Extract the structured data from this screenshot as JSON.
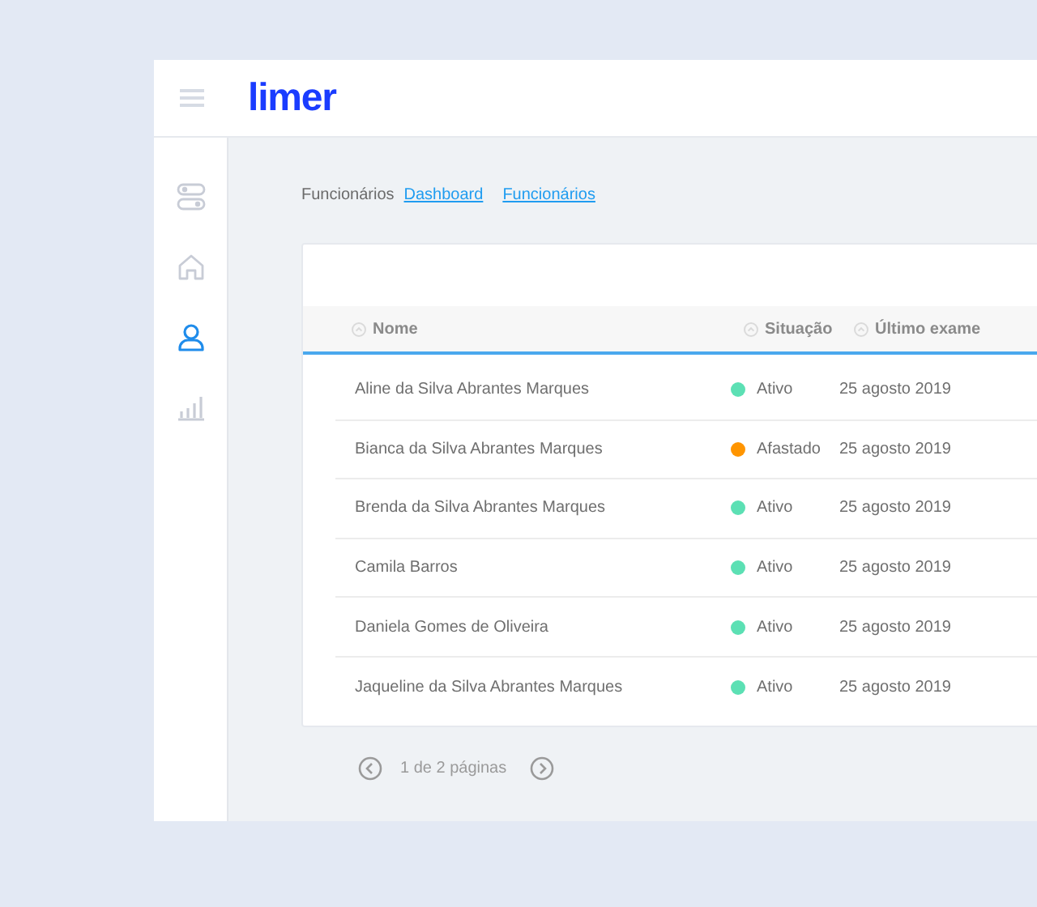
{
  "header": {
    "logo": "limer"
  },
  "sidebar": {
    "items": [
      {
        "kind": "toggles",
        "selected": false
      },
      {
        "kind": "home",
        "selected": false
      },
      {
        "kind": "user",
        "selected": true
      },
      {
        "kind": "chart",
        "selected": false
      }
    ]
  },
  "breadcrumb": {
    "title": "Funcionários",
    "links": [
      "Dashboard",
      "Funcionários"
    ]
  },
  "table": {
    "columns": [
      "Nome",
      "Situação",
      "Último exame"
    ],
    "rows": [
      {
        "name": "Aline da Silva Abrantes Marques",
        "status": "Ativo",
        "color": "#5ce0b4",
        "date": "25 agosto 2019"
      },
      {
        "name": "Bianca da Silva Abrantes Marques",
        "status": "Afastado",
        "color": "#ff9500",
        "date": "25 agosto 2019"
      },
      {
        "name": "Brenda da Silva Abrantes Marques",
        "status": "Ativo",
        "color": "#5ce0b4",
        "date": "25 agosto 2019"
      },
      {
        "name": "Camila Barros",
        "status": "Ativo",
        "color": "#5ce0b4",
        "date": "25 agosto 2019"
      },
      {
        "name": "Daniela Gomes de Oliveira",
        "status": "Ativo",
        "color": "#5ce0b4",
        "date": "25 agosto 2019"
      },
      {
        "name": "Jaqueline da Silva Abrantes Marques",
        "status": "Ativo",
        "color": "#5ce0b4",
        "date": "25 agosto 2019"
      }
    ]
  },
  "pagination": {
    "label": "1 de 2 páginas"
  }
}
